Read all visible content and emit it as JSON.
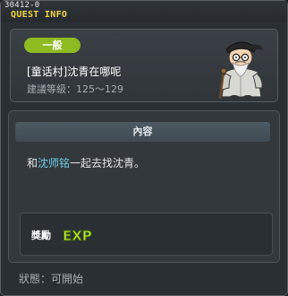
{
  "window": {
    "quest_id": "30412-0",
    "title": "QUEST INFO"
  },
  "quest": {
    "category": "一般",
    "name": "[童话村]沈青在哪呢",
    "level_range": "建議等級：125～129",
    "npc_icon": "old-man-npc-portrait"
  },
  "content": {
    "header": "內容",
    "text_prefix": "和",
    "npc_name": "沈师铭",
    "text_suffix": "一起去找沈青。"
  },
  "reward": {
    "label": "獎勵",
    "exp_label": "EXP"
  },
  "status": {
    "text": "狀態：可開始"
  },
  "colors": {
    "title": "#f3d641",
    "badge": "#8fbb22",
    "npc_highlight": "#6ecfe8",
    "exp": "#b8e83a"
  }
}
